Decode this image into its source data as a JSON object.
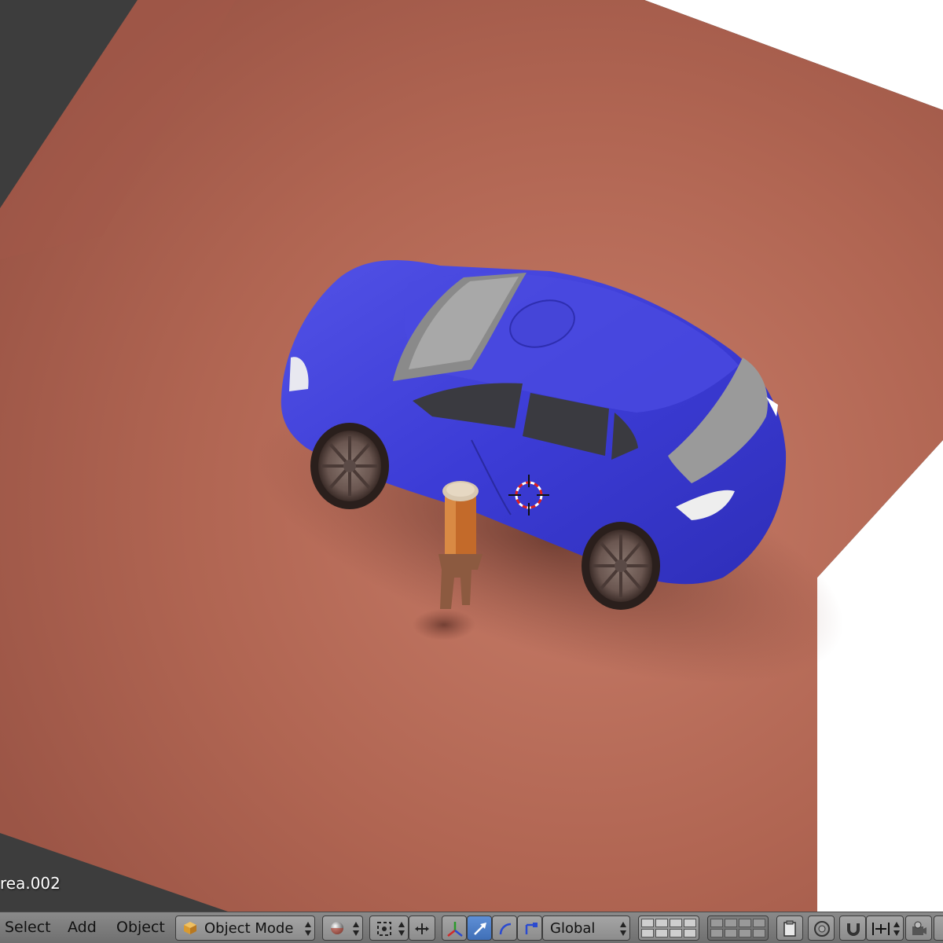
{
  "viewport": {
    "active_object_label": "rea.002",
    "colors": {
      "floor": "#b86a58",
      "car_body": "#3a3ad0",
      "background_dark": "#3d3d3d",
      "background_light": "#ffffff"
    }
  },
  "header": {
    "menu": {
      "select": "Select",
      "add": "Add",
      "object": "Object"
    },
    "mode_selector": {
      "value": "Object Mode",
      "icon": "cube-icon"
    },
    "viewport_shading": {
      "icon": "sphere-shading-icon"
    },
    "pivot_point": {
      "icon": "pivot-point-icon"
    },
    "transform_orientation": {
      "value": "Global"
    },
    "icons": [
      "manipulator-axis-icon",
      "translate-arrow-icon",
      "rotate-arc-icon",
      "scale-arrow-icon",
      "layers-grid-icon",
      "layers-grid-icon",
      "clipboard-icon",
      "proportional-edit-icon",
      "snap-magnet-icon",
      "snap-element-icon",
      "render-camera-icon"
    ]
  }
}
